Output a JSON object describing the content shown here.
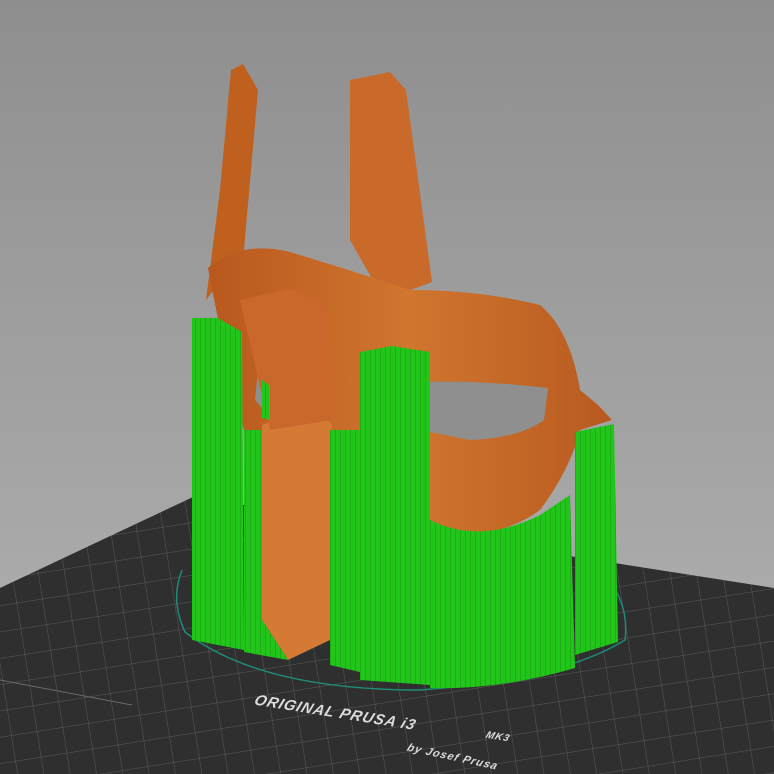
{
  "viewport": {
    "bed_label": {
      "title": "ORIGINAL PRUSA i3",
      "model": "MK3",
      "author": "by Josef Prusa"
    },
    "colors": {
      "background": "#a3a3a3",
      "bed": "#2f2f2f",
      "bed_grid": "#5a5a5a",
      "model": "#c96a2a",
      "support": "#22c51a",
      "skirt": "#1f8a7a"
    },
    "icons": [
      "print-bed-icon",
      "model-mesh-icon",
      "support-structure-icon"
    ]
  }
}
